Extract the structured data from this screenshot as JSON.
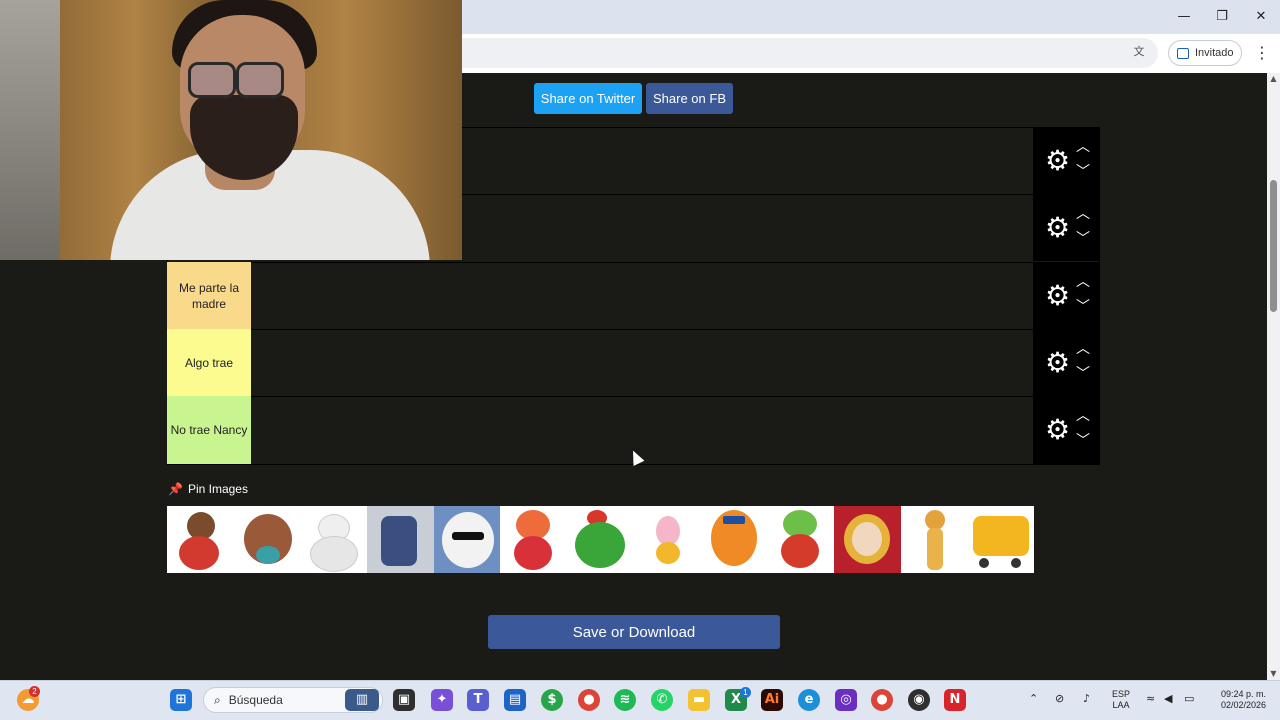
{
  "browser": {
    "profile_label": "Invitado"
  },
  "share": {
    "twitter_label": "Share on Twitter",
    "fb_label": "Share on FB"
  },
  "tiers": [
    {
      "label": "",
      "color": "#1a1a17"
    },
    {
      "label": "",
      "color": "#1a1a17"
    },
    {
      "label": "Me parte la madre",
      "color": "#f9d98a"
    },
    {
      "label": "Algo trae",
      "color": "#fbfb8f"
    },
    {
      "label": "No trae Nancy",
      "color": "#c8f58f"
    }
  ],
  "pin": {
    "label": "Pin Images",
    "images": [
      "boy-mascot-image",
      "dog-mascot-image",
      "michelin-man-image",
      "bunny-suit-image",
      "polar-bear-image",
      "clown-mascot-image",
      "rooster-mascot-image",
      "pink-bunny-image",
      "tiger-mascot-image",
      "frog-mascot-image",
      "abuelita-image",
      "cheetah-mascot-image",
      "cart-mascot-image"
    ]
  },
  "save_label": "Save or Download",
  "taskbar": {
    "search_placeholder": "Búsqueda",
    "language_line1": "ESP",
    "language_line2": "LAA",
    "time": "09:24 p. m.",
    "date": "02/02/2026",
    "weather_badge": "2",
    "store_badge": "1"
  }
}
